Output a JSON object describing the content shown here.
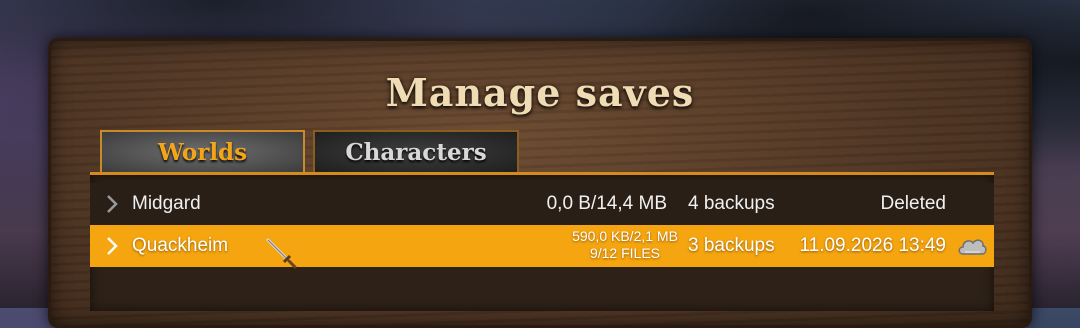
{
  "title": "Manage saves",
  "tabs": [
    {
      "label": "Worlds",
      "active": true
    },
    {
      "label": "Characters",
      "active": false
    }
  ],
  "saves": [
    {
      "name": "Midgard",
      "size": "0,0 B/14,4 MB",
      "backups": "4 backups",
      "status": "Deleted",
      "selected": false
    },
    {
      "name": "Quackheim",
      "size": "590,0 KB/2,1 MB",
      "files": "9/12 FILES",
      "backups": "3 backups",
      "status": "11.09.2026 13:49",
      "selected": true,
      "icon": "cloud-icon"
    }
  ],
  "colors": {
    "accent": "#f5a50f",
    "tab_active_text": "#f2a51b",
    "title": "#f0dcb4"
  }
}
